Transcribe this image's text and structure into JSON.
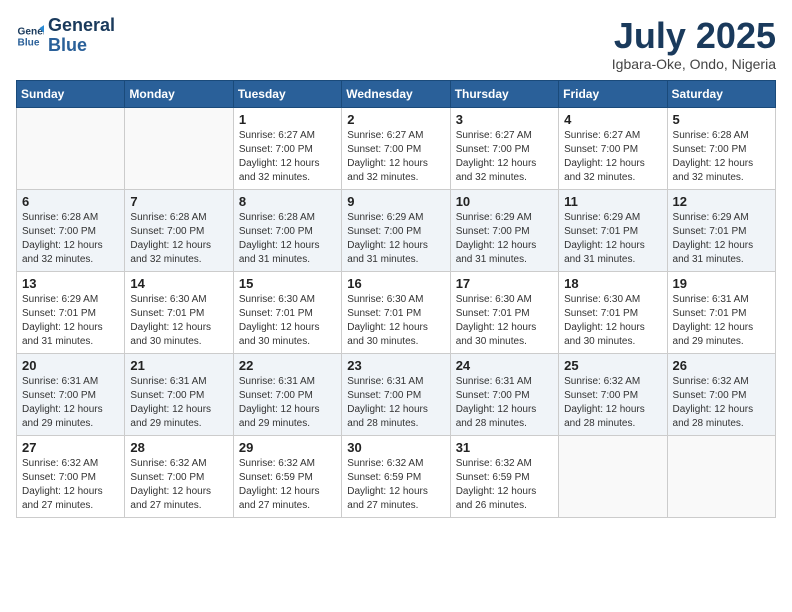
{
  "logo": {
    "line1": "General",
    "line2": "Blue"
  },
  "title": "July 2025",
  "subtitle": "Igbara-Oke, Ondo, Nigeria",
  "weekdays": [
    "Sunday",
    "Monday",
    "Tuesday",
    "Wednesday",
    "Thursday",
    "Friday",
    "Saturday"
  ],
  "weeks": [
    [
      {
        "day": "",
        "info": ""
      },
      {
        "day": "",
        "info": ""
      },
      {
        "day": "1",
        "info": "Sunrise: 6:27 AM\nSunset: 7:00 PM\nDaylight: 12 hours and 32 minutes."
      },
      {
        "day": "2",
        "info": "Sunrise: 6:27 AM\nSunset: 7:00 PM\nDaylight: 12 hours and 32 minutes."
      },
      {
        "day": "3",
        "info": "Sunrise: 6:27 AM\nSunset: 7:00 PM\nDaylight: 12 hours and 32 minutes."
      },
      {
        "day": "4",
        "info": "Sunrise: 6:27 AM\nSunset: 7:00 PM\nDaylight: 12 hours and 32 minutes."
      },
      {
        "day": "5",
        "info": "Sunrise: 6:28 AM\nSunset: 7:00 PM\nDaylight: 12 hours and 32 minutes."
      }
    ],
    [
      {
        "day": "6",
        "info": "Sunrise: 6:28 AM\nSunset: 7:00 PM\nDaylight: 12 hours and 32 minutes."
      },
      {
        "day": "7",
        "info": "Sunrise: 6:28 AM\nSunset: 7:00 PM\nDaylight: 12 hours and 32 minutes."
      },
      {
        "day": "8",
        "info": "Sunrise: 6:28 AM\nSunset: 7:00 PM\nDaylight: 12 hours and 31 minutes."
      },
      {
        "day": "9",
        "info": "Sunrise: 6:29 AM\nSunset: 7:00 PM\nDaylight: 12 hours and 31 minutes."
      },
      {
        "day": "10",
        "info": "Sunrise: 6:29 AM\nSunset: 7:00 PM\nDaylight: 12 hours and 31 minutes."
      },
      {
        "day": "11",
        "info": "Sunrise: 6:29 AM\nSunset: 7:01 PM\nDaylight: 12 hours and 31 minutes."
      },
      {
        "day": "12",
        "info": "Sunrise: 6:29 AM\nSunset: 7:01 PM\nDaylight: 12 hours and 31 minutes."
      }
    ],
    [
      {
        "day": "13",
        "info": "Sunrise: 6:29 AM\nSunset: 7:01 PM\nDaylight: 12 hours and 31 minutes."
      },
      {
        "day": "14",
        "info": "Sunrise: 6:30 AM\nSunset: 7:01 PM\nDaylight: 12 hours and 30 minutes."
      },
      {
        "day": "15",
        "info": "Sunrise: 6:30 AM\nSunset: 7:01 PM\nDaylight: 12 hours and 30 minutes."
      },
      {
        "day": "16",
        "info": "Sunrise: 6:30 AM\nSunset: 7:01 PM\nDaylight: 12 hours and 30 minutes."
      },
      {
        "day": "17",
        "info": "Sunrise: 6:30 AM\nSunset: 7:01 PM\nDaylight: 12 hours and 30 minutes."
      },
      {
        "day": "18",
        "info": "Sunrise: 6:30 AM\nSunset: 7:01 PM\nDaylight: 12 hours and 30 minutes."
      },
      {
        "day": "19",
        "info": "Sunrise: 6:31 AM\nSunset: 7:01 PM\nDaylight: 12 hours and 29 minutes."
      }
    ],
    [
      {
        "day": "20",
        "info": "Sunrise: 6:31 AM\nSunset: 7:00 PM\nDaylight: 12 hours and 29 minutes."
      },
      {
        "day": "21",
        "info": "Sunrise: 6:31 AM\nSunset: 7:00 PM\nDaylight: 12 hours and 29 minutes."
      },
      {
        "day": "22",
        "info": "Sunrise: 6:31 AM\nSunset: 7:00 PM\nDaylight: 12 hours and 29 minutes."
      },
      {
        "day": "23",
        "info": "Sunrise: 6:31 AM\nSunset: 7:00 PM\nDaylight: 12 hours and 28 minutes."
      },
      {
        "day": "24",
        "info": "Sunrise: 6:31 AM\nSunset: 7:00 PM\nDaylight: 12 hours and 28 minutes."
      },
      {
        "day": "25",
        "info": "Sunrise: 6:32 AM\nSunset: 7:00 PM\nDaylight: 12 hours and 28 minutes."
      },
      {
        "day": "26",
        "info": "Sunrise: 6:32 AM\nSunset: 7:00 PM\nDaylight: 12 hours and 28 minutes."
      }
    ],
    [
      {
        "day": "27",
        "info": "Sunrise: 6:32 AM\nSunset: 7:00 PM\nDaylight: 12 hours and 27 minutes."
      },
      {
        "day": "28",
        "info": "Sunrise: 6:32 AM\nSunset: 7:00 PM\nDaylight: 12 hours and 27 minutes."
      },
      {
        "day": "29",
        "info": "Sunrise: 6:32 AM\nSunset: 6:59 PM\nDaylight: 12 hours and 27 minutes."
      },
      {
        "day": "30",
        "info": "Sunrise: 6:32 AM\nSunset: 6:59 PM\nDaylight: 12 hours and 27 minutes."
      },
      {
        "day": "31",
        "info": "Sunrise: 6:32 AM\nSunset: 6:59 PM\nDaylight: 12 hours and 26 minutes."
      },
      {
        "day": "",
        "info": ""
      },
      {
        "day": "",
        "info": ""
      }
    ]
  ]
}
